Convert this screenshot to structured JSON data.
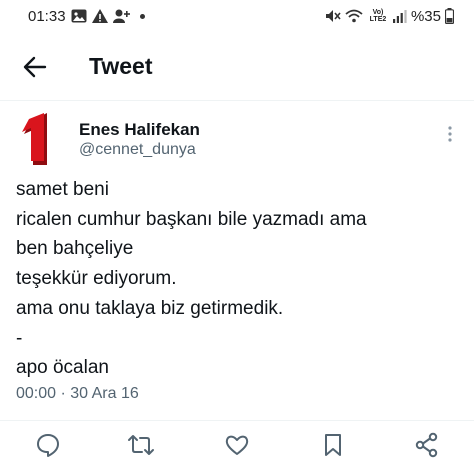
{
  "status_bar": {
    "time": "01:33",
    "network_label": "Vo) LTE2",
    "battery": "%35"
  },
  "app_bar": {
    "title": "Tweet"
  },
  "tweet": {
    "author_name": "Enes Halifekan",
    "author_handle": "@cennet_dunya",
    "text": "samet beni\nricalen cumhur başkanı bile yazmadı ama\nben bahçeliye\nteşekkür ediyorum.\nama onu taklaya biz getirmedik.\n-\napo öcalan",
    "timestamp": "00:00 · 30 Ara 16"
  },
  "icons": {
    "status_left": [
      "gallery-icon",
      "alert-icon",
      "add-user-icon",
      "dot-icon"
    ],
    "status_right": [
      "mute-icon",
      "wifi-icon",
      "signal-icon",
      "battery-icon"
    ],
    "actions": [
      "reply-icon",
      "retweet-icon",
      "like-icon",
      "bookmark-icon",
      "share-icon"
    ]
  },
  "colors": {
    "text": "#0f1419",
    "secondary": "#536471",
    "avatar_red": "#d9151d",
    "divider": "#eff3f4"
  }
}
